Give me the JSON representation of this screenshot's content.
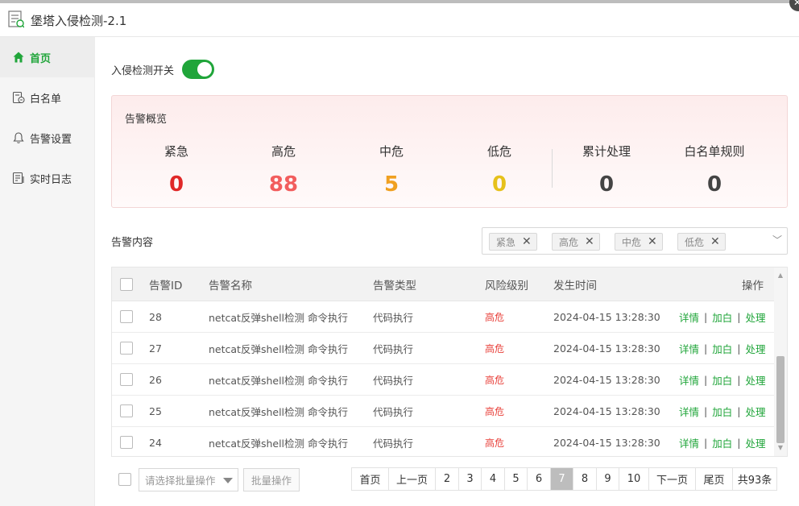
{
  "window": {
    "title": "堡塔入侵检测-2.1"
  },
  "sidebar": {
    "items": [
      {
        "label": "首页",
        "icon": "home-icon"
      },
      {
        "label": "白名单",
        "icon": "whitelist-icon"
      },
      {
        "label": "告警设置",
        "icon": "bell-icon"
      },
      {
        "label": "实时日志",
        "icon": "log-icon"
      }
    ]
  },
  "toggle": {
    "label": "入侵检测开关",
    "state": "on"
  },
  "overview": {
    "title": "告警概览",
    "stats": [
      {
        "label": "紧急",
        "value": "0",
        "color": "#e02828"
      },
      {
        "label": "高危",
        "value": "88",
        "color": "#f25d5d"
      },
      {
        "label": "中危",
        "value": "5",
        "color": "#f0a020"
      },
      {
        "label": "低危",
        "value": "0",
        "color": "#e6c11b"
      },
      {
        "label": "累计处理",
        "value": "0",
        "color": "#444444"
      },
      {
        "label": "白名单规则",
        "value": "0",
        "color": "#444444"
      }
    ]
  },
  "alerts": {
    "title": "告警内容",
    "filters": [
      "紧急",
      "高危",
      "中危",
      "低危"
    ],
    "columns": [
      "告警ID",
      "告警名称",
      "告警类型",
      "风险级别",
      "发生时间",
      "操作"
    ],
    "rows": [
      {
        "id": "28",
        "name": "netcat反弹shell检测 命令执行",
        "type": "代码执行",
        "risk": "高危",
        "time": "2024-04-15 13:28:30"
      },
      {
        "id": "27",
        "name": "netcat反弹shell检测 命令执行",
        "type": "代码执行",
        "risk": "高危",
        "time": "2024-04-15 13:28:30"
      },
      {
        "id": "26",
        "name": "netcat反弹shell检测 命令执行",
        "type": "代码执行",
        "risk": "高危",
        "time": "2024-04-15 13:28:30"
      },
      {
        "id": "25",
        "name": "netcat反弹shell检测 命令执行",
        "type": "代码执行",
        "risk": "高危",
        "time": "2024-04-15 13:28:30"
      },
      {
        "id": "24",
        "name": "netcat反弹shell检测 命令执行",
        "type": "代码执行",
        "risk": "高危",
        "time": "2024-04-15 13:28:30"
      }
    ],
    "actions": {
      "detail": "详情",
      "whitelist": "加白",
      "handle": "处理",
      "separator": "|"
    }
  },
  "batch": {
    "placeholder": "请选择批量操作",
    "button": "批量操作"
  },
  "pagination": {
    "first": "首页",
    "prev": "上一页",
    "pages": [
      "2",
      "3",
      "4",
      "5",
      "6",
      "7",
      "8",
      "9",
      "10"
    ],
    "current": "7",
    "next": "下一页",
    "last": "尾页",
    "total": "共93条"
  },
  "colors": {
    "accent": "#20a53a",
    "danger": "#e8403a"
  }
}
